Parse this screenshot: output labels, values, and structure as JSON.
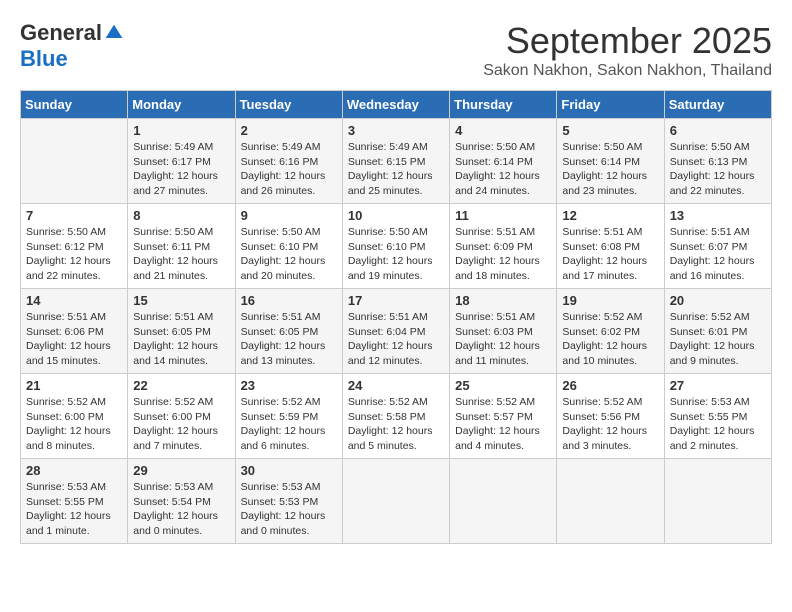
{
  "logo": {
    "general": "General",
    "blue": "Blue"
  },
  "title": "September 2025",
  "location": "Sakon Nakhon, Sakon Nakhon, Thailand",
  "weekdays": [
    "Sunday",
    "Monday",
    "Tuesday",
    "Wednesday",
    "Thursday",
    "Friday",
    "Saturday"
  ],
  "weeks": [
    [
      null,
      {
        "day": "1",
        "sunrise": "5:49 AM",
        "sunset": "6:17 PM",
        "daylight": "12 hours and 27 minutes."
      },
      {
        "day": "2",
        "sunrise": "5:49 AM",
        "sunset": "6:16 PM",
        "daylight": "12 hours and 26 minutes."
      },
      {
        "day": "3",
        "sunrise": "5:49 AM",
        "sunset": "6:15 PM",
        "daylight": "12 hours and 25 minutes."
      },
      {
        "day": "4",
        "sunrise": "5:50 AM",
        "sunset": "6:14 PM",
        "daylight": "12 hours and 24 minutes."
      },
      {
        "day": "5",
        "sunrise": "5:50 AM",
        "sunset": "6:14 PM",
        "daylight": "12 hours and 23 minutes."
      },
      {
        "day": "6",
        "sunrise": "5:50 AM",
        "sunset": "6:13 PM",
        "daylight": "12 hours and 22 minutes."
      }
    ],
    [
      {
        "day": "7",
        "sunrise": "5:50 AM",
        "sunset": "6:12 PM",
        "daylight": "12 hours and 22 minutes."
      },
      {
        "day": "8",
        "sunrise": "5:50 AM",
        "sunset": "6:11 PM",
        "daylight": "12 hours and 21 minutes."
      },
      {
        "day": "9",
        "sunrise": "5:50 AM",
        "sunset": "6:10 PM",
        "daylight": "12 hours and 20 minutes."
      },
      {
        "day": "10",
        "sunrise": "5:50 AM",
        "sunset": "6:10 PM",
        "daylight": "12 hours and 19 minutes."
      },
      {
        "day": "11",
        "sunrise": "5:51 AM",
        "sunset": "6:09 PM",
        "daylight": "12 hours and 18 minutes."
      },
      {
        "day": "12",
        "sunrise": "5:51 AM",
        "sunset": "6:08 PM",
        "daylight": "12 hours and 17 minutes."
      },
      {
        "day": "13",
        "sunrise": "5:51 AM",
        "sunset": "6:07 PM",
        "daylight": "12 hours and 16 minutes."
      }
    ],
    [
      {
        "day": "14",
        "sunrise": "5:51 AM",
        "sunset": "6:06 PM",
        "daylight": "12 hours and 15 minutes."
      },
      {
        "day": "15",
        "sunrise": "5:51 AM",
        "sunset": "6:05 PM",
        "daylight": "12 hours and 14 minutes."
      },
      {
        "day": "16",
        "sunrise": "5:51 AM",
        "sunset": "6:05 PM",
        "daylight": "12 hours and 13 minutes."
      },
      {
        "day": "17",
        "sunrise": "5:51 AM",
        "sunset": "6:04 PM",
        "daylight": "12 hours and 12 minutes."
      },
      {
        "day": "18",
        "sunrise": "5:51 AM",
        "sunset": "6:03 PM",
        "daylight": "12 hours and 11 minutes."
      },
      {
        "day": "19",
        "sunrise": "5:52 AM",
        "sunset": "6:02 PM",
        "daylight": "12 hours and 10 minutes."
      },
      {
        "day": "20",
        "sunrise": "5:52 AM",
        "sunset": "6:01 PM",
        "daylight": "12 hours and 9 minutes."
      }
    ],
    [
      {
        "day": "21",
        "sunrise": "5:52 AM",
        "sunset": "6:00 PM",
        "daylight": "12 hours and 8 minutes."
      },
      {
        "day": "22",
        "sunrise": "5:52 AM",
        "sunset": "6:00 PM",
        "daylight": "12 hours and 7 minutes."
      },
      {
        "day": "23",
        "sunrise": "5:52 AM",
        "sunset": "5:59 PM",
        "daylight": "12 hours and 6 minutes."
      },
      {
        "day": "24",
        "sunrise": "5:52 AM",
        "sunset": "5:58 PM",
        "daylight": "12 hours and 5 minutes."
      },
      {
        "day": "25",
        "sunrise": "5:52 AM",
        "sunset": "5:57 PM",
        "daylight": "12 hours and 4 minutes."
      },
      {
        "day": "26",
        "sunrise": "5:52 AM",
        "sunset": "5:56 PM",
        "daylight": "12 hours and 3 minutes."
      },
      {
        "day": "27",
        "sunrise": "5:53 AM",
        "sunset": "5:55 PM",
        "daylight": "12 hours and 2 minutes."
      }
    ],
    [
      {
        "day": "28",
        "sunrise": "5:53 AM",
        "sunset": "5:55 PM",
        "daylight": "12 hours and 1 minute."
      },
      {
        "day": "29",
        "sunrise": "5:53 AM",
        "sunset": "5:54 PM",
        "daylight": "12 hours and 0 minutes."
      },
      {
        "day": "30",
        "sunrise": "5:53 AM",
        "sunset": "5:53 PM",
        "daylight": "12 hours and 0 minutes."
      },
      null,
      null,
      null,
      null
    ]
  ],
  "labels": {
    "sunrise": "Sunrise:",
    "sunset": "Sunset:",
    "daylight": "Daylight:"
  }
}
